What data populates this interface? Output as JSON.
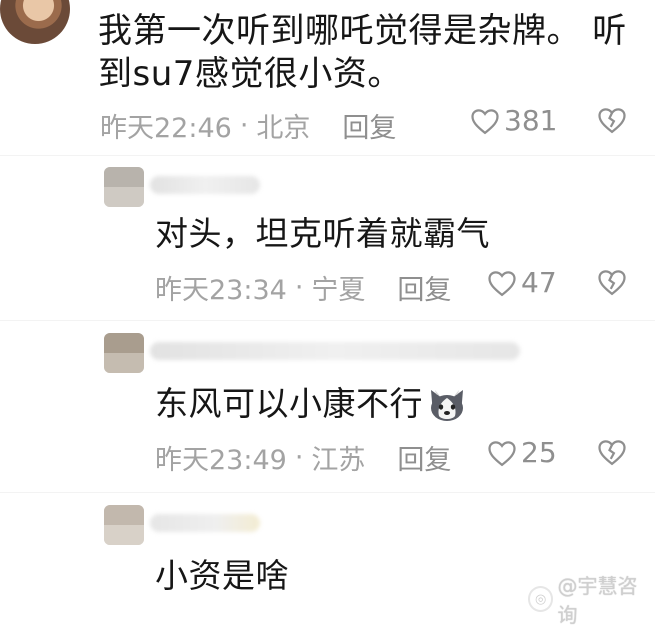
{
  "top_comment": {
    "text": "我第一次听到哪吒觉得是杂牌。 听到su7感觉很小资。",
    "time": "昨天22:46",
    "sep": "·",
    "location": "北京",
    "reply_label": "回复",
    "likes": "381"
  },
  "replies": [
    {
      "text": "对头，坦克听着就霸气",
      "time": "昨天23:34",
      "sep": "·",
      "location": "宁夏",
      "reply_label": "回复",
      "likes": "47"
    },
    {
      "text": "东风可以小康不行",
      "emoji": "husky-emoji",
      "time": "昨天23:49",
      "sep": "·",
      "location": "江苏",
      "reply_label": "回复",
      "likes": "25"
    },
    {
      "text": "小资是啥"
    }
  ],
  "watermark": {
    "text": "@宇慧咨询"
  },
  "icons": {
    "like": "heart-outline-icon",
    "dislike": "broken-heart-icon"
  },
  "colors": {
    "meta": "#a3a3a3",
    "text": "#161616"
  }
}
